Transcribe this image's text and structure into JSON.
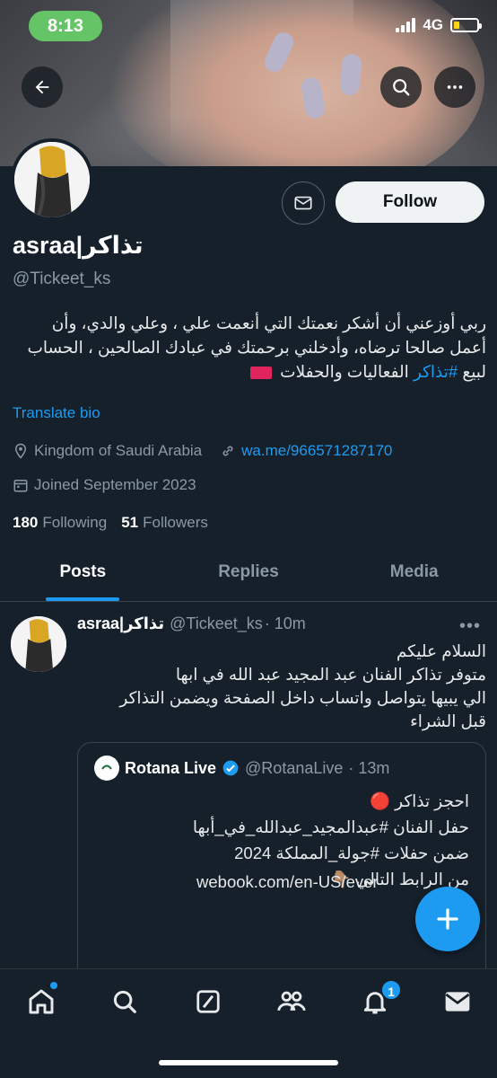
{
  "status_bar": {
    "time": "8:13",
    "network": "4G"
  },
  "profile": {
    "display_name": "asraa|تذاكر",
    "handle": "@Tickeet_ks",
    "bio_text": "ربي أوزعني أن أشكر نعمتك التي أنعمت علي ، وعلي والدي، وأن أعمل صالحا ترضاه، وأدخلني برحمتك في عبادك الصالحين ، الحساب لبيع",
    "bio_hashtag": "#تذاكر",
    "bio_tail": " الفعاليات والحفلات",
    "translate_label": "Translate bio",
    "location": "Kingdom of Saudi Arabia",
    "link": "wa.me/966571287170",
    "joined": "Joined September 2023",
    "following_count": "180",
    "following_label": "Following",
    "followers_count": "51",
    "followers_label": "Followers",
    "follow_button": "Follow"
  },
  "tabs": [
    {
      "label": "Posts",
      "active": true
    },
    {
      "label": "Replies",
      "active": false
    },
    {
      "label": "Media",
      "active": false
    }
  ],
  "tweet": {
    "name": "asraa|تذاكر",
    "handle": "@Tickeet_ks",
    "time": "· 10m",
    "lines": [
      "السلام عليكم",
      "متوفر تذاكر الفنان عبد المجيد عبد الله في ابها",
      "الي يبيها يتواصل واتساب داخل الصفحة ويضمن التذاكر",
      "قبل الشراء"
    ],
    "quote": {
      "name": "Rotana Live",
      "handle": "@RotanaLive",
      "time": "· 13m",
      "lines": [
        "احجز تذاكر 🔴",
        "حفل الفنان #عبدالمجيد_عبدالله_في_أبها",
        "ضمن حفلات #جولة_المملكة 2024",
        "من الرابط التالي 👇🏽"
      ],
      "link": "webook.com/en-US/ever"
    }
  },
  "notifications_badge": "1",
  "colors": {
    "accent": "#1d9bf0",
    "background": "#15202b",
    "status_green": "#65c466"
  }
}
